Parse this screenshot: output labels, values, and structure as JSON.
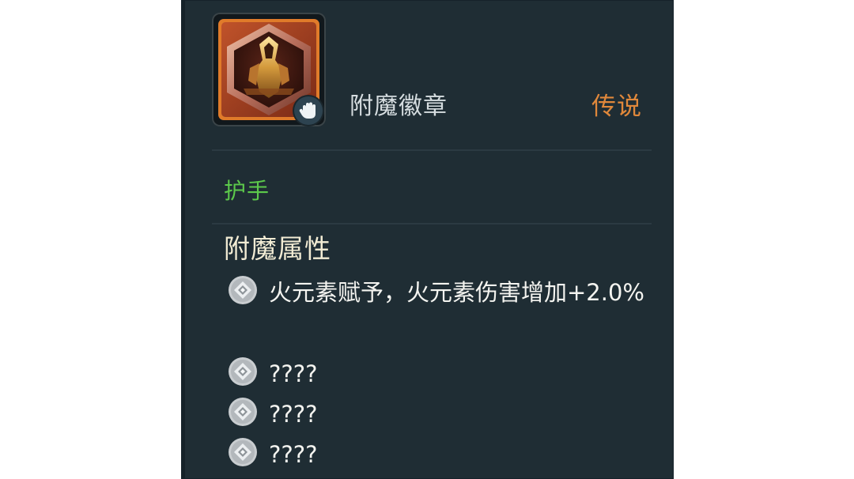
{
  "item": {
    "name": "附魔徽章",
    "rarity": "传说",
    "type": "护手",
    "icon": "enchant-badge-hexagon-icon",
    "badge_icon": "glove-icon"
  },
  "colors": {
    "panel": "#1f2d34",
    "rarity": "#e0883b",
    "type": "#5cc94b",
    "section_title": "#f2ecd4",
    "text": "#f4f4f0"
  },
  "attributes": {
    "title": "附魔属性",
    "items": [
      {
        "icon": "diamond-bullet-icon",
        "text": "火元素赋予，火元素伤害增加+2.0%"
      },
      {
        "icon": "diamond-bullet-icon",
        "text": "????"
      },
      {
        "icon": "diamond-bullet-icon",
        "text": "????"
      },
      {
        "icon": "diamond-bullet-icon",
        "text": "????"
      }
    ]
  }
}
